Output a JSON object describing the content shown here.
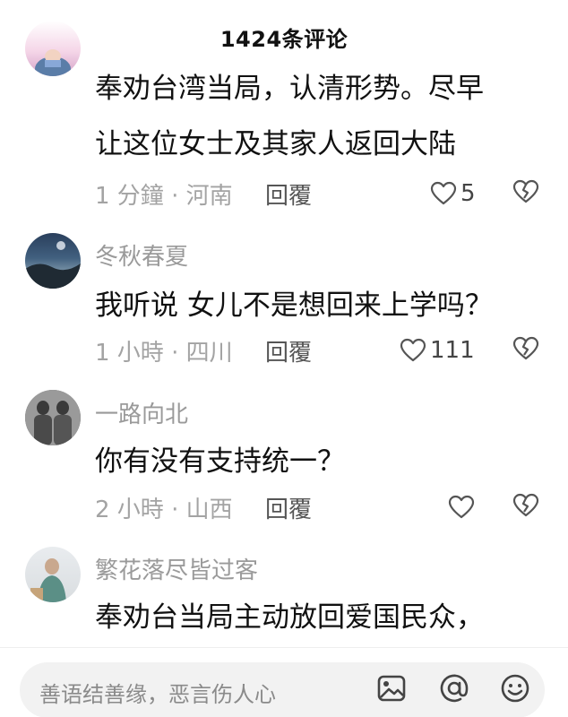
{
  "header": {
    "title": "1424条评论"
  },
  "comments": [
    {
      "name": "",
      "lines": [
        "奉劝台湾当局，认清形势。尽早",
        "让这位女士及其家人返回大陆"
      ],
      "time": "1 分鐘 · 河南",
      "reply": "回覆",
      "likes": "5"
    },
    {
      "name": "冬秋春夏",
      "lines": [
        "我听说 女儿不是想回来上学吗？"
      ],
      "time": "1 小時 · 四川",
      "reply": "回覆",
      "likes": "111"
    },
    {
      "name": "一路向北",
      "lines": [
        "你有没有支持统一？"
      ],
      "time": "2 小時 · 山西",
      "reply": "回覆",
      "likes": ""
    },
    {
      "name": "繁花落尽皆过客",
      "lines": [
        "奉劝台当局主动放回爱国民众，"
      ],
      "time": "",
      "reply": "",
      "likes": ""
    }
  ],
  "composer": {
    "placeholder": "善语结善缘，恶言伤人心"
  },
  "icons": {
    "like": "heart-outline-icon",
    "dislike": "broken-heart-icon",
    "image": "image-icon",
    "mention": "at-icon",
    "emoji": "smiley-icon"
  },
  "colors": {
    "muted_text": "#9a9a9a",
    "body_text": "#111111",
    "input_bg": "#f2f2f2"
  }
}
